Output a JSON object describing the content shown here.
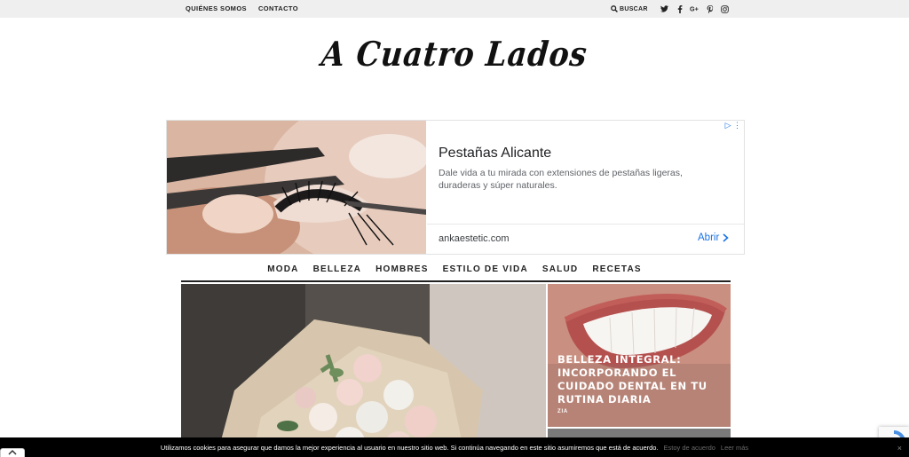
{
  "topbar": {
    "nav": [
      "QUIÉNES SOMOS",
      "CONTACTO"
    ],
    "search_label": "BUSCAR",
    "social": [
      {
        "icon": "twitter-icon",
        "glyph": "t"
      },
      {
        "icon": "facebook-icon",
        "glyph": "f"
      },
      {
        "icon": "google-plus-icon",
        "glyph": "G+"
      },
      {
        "icon": "pinterest-icon",
        "glyph": "p"
      },
      {
        "icon": "instagram-icon",
        "glyph": ""
      }
    ]
  },
  "site": {
    "logo": "A Cuatro Lados"
  },
  "ad": {
    "title": "Pestañas Alicante",
    "description": "Dale vida a tu mirada con extensiones de pestañas ligeras, duraderas y súper naturales.",
    "url": "ankaestetic.com",
    "cta": "Abrir",
    "cta_color": "#1a73e8"
  },
  "main_nav": [
    "MODA",
    "BELLEZA",
    "HOMBRES",
    "ESTILO DE VIDA",
    "SALUD",
    "RECETAS"
  ],
  "featured": {
    "side_article": {
      "title": "BELLEZA INTEGRAL: INCORPORANDO EL CUIDADO DENTAL EN TU RUTINA DIARIA",
      "author": "ZIA"
    }
  },
  "cookie_bar": {
    "message": "Utilizamos cookies para asegurar que damos la mejor experiencia al usuario en nuestro sitio web. Si continúa navegando en este sitio asumiremos que está de acuerdo.",
    "accept": "Estoy de acuerdo",
    "more": "Leer más",
    "close": "×"
  }
}
